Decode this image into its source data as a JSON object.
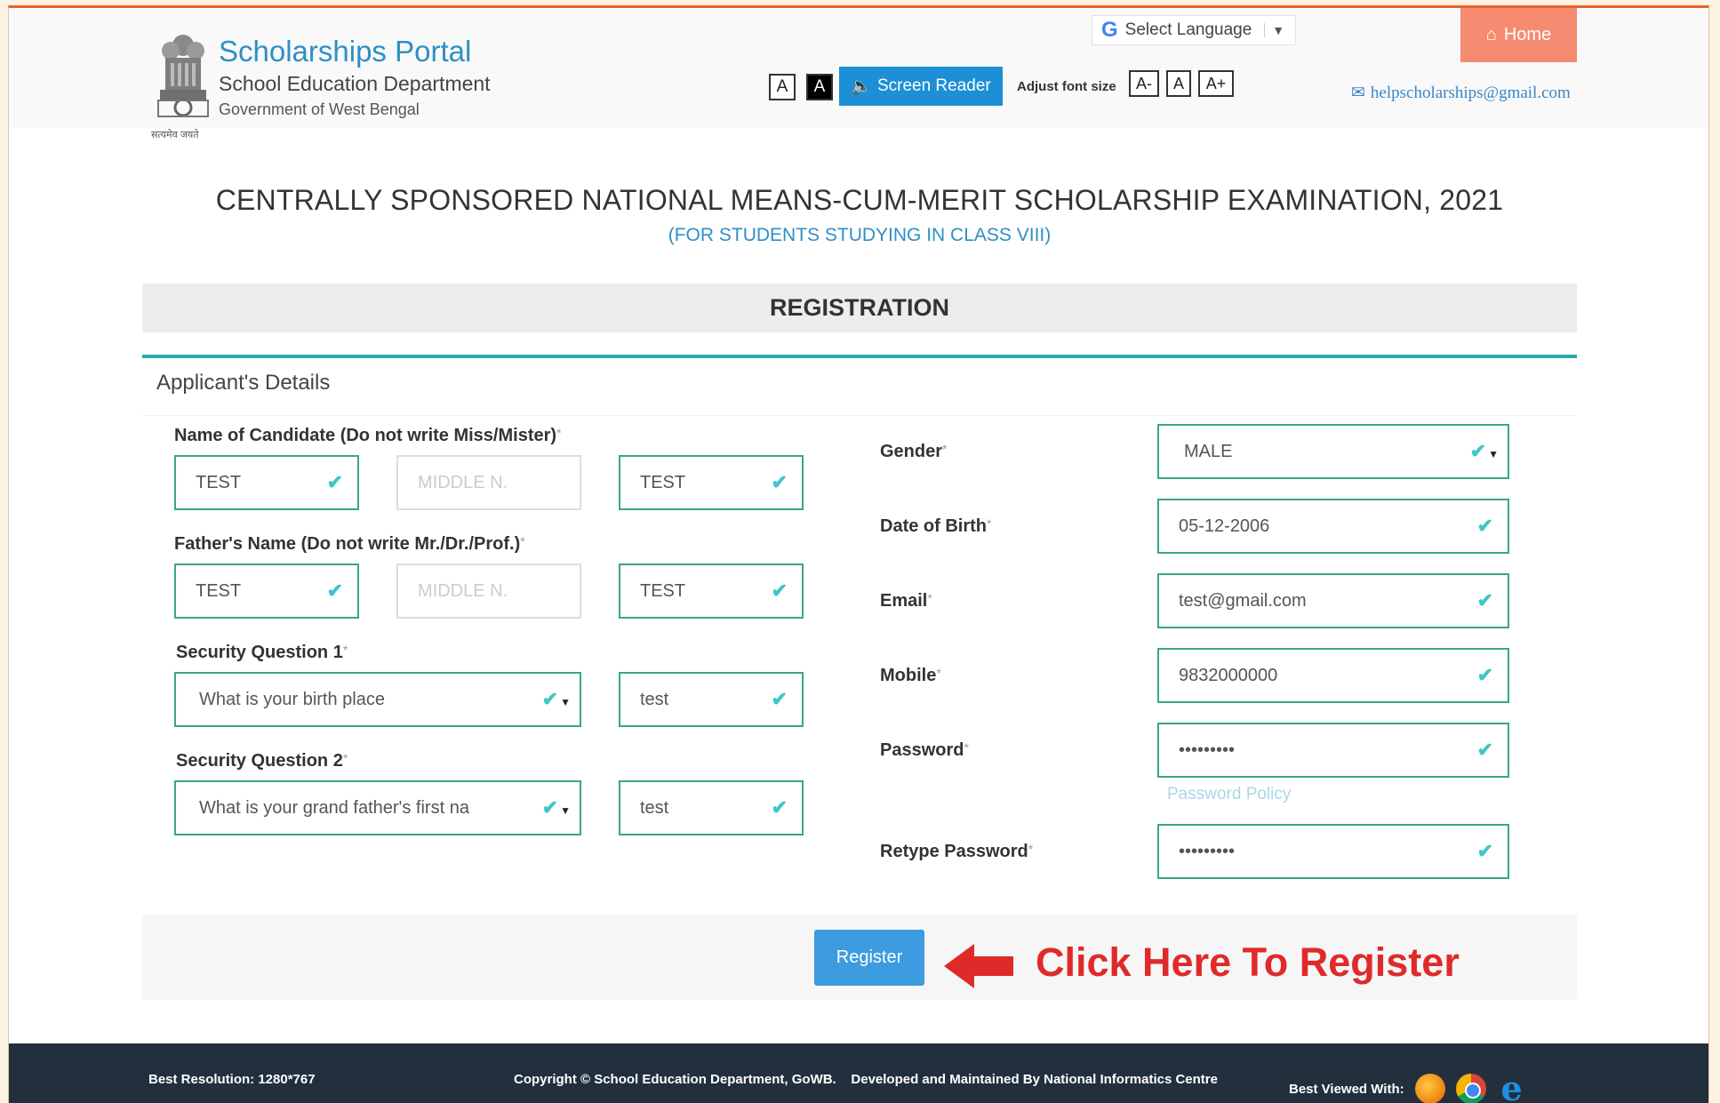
{
  "header": {
    "title": "Scholarships Portal",
    "department": "School Education Department",
    "government": "Government of West Bengal",
    "emblem_caption": "सत्यमेव जयते",
    "language": "Select Language",
    "home": "Home",
    "font_a_light": "A",
    "font_a_dark": "A",
    "screen_reader": "Screen Reader",
    "adjust_font_label": "Adjust font size",
    "font_decrease": "A-",
    "font_normal": "A",
    "font_increase": "A+",
    "email": "helpscholarships@gmail.com"
  },
  "page": {
    "title": "CENTRALLY SPONSORED NATIONAL MEANS-CUM-MERIT SCHOLARSHIP EXAMINATION, 2021",
    "subtitle": "(FOR STUDENTS STUDYING IN CLASS VIII)",
    "section": "REGISTRATION",
    "panel_title": "Applicant's Details"
  },
  "form": {
    "candidate_label": "Name of Candidate (Do not write Miss/Mister)",
    "candidate_first": "TEST",
    "candidate_middle_placeholder": "MIDDLE N.",
    "candidate_last": "TEST",
    "father_label": "Father's Name (Do not write Mr./Dr./Prof.)",
    "father_first": "TEST",
    "father_middle_placeholder": "MIDDLE N.",
    "father_last": "TEST",
    "sq1_label": "Security Question 1",
    "sq1_question": "What is your birth place",
    "sq1_answer": "test",
    "sq2_label": "Security Question 2",
    "sq2_question": "What is your grand father's first na",
    "sq2_answer": "test",
    "gender_label": "Gender",
    "gender_value": "MALE",
    "dob_label": "Date of Birth",
    "dob_value": "05-12-2006",
    "email_label": "Email",
    "email_value": "test@gmail.com",
    "mobile_label": "Mobile",
    "mobile_value": "9832000000",
    "password_label": "Password",
    "password_value": "•••••••••",
    "password_policy": "Password Policy",
    "retype_label": "Retype Password",
    "retype_value": "•••••••••",
    "required_mark": "*"
  },
  "actions": {
    "register": "Register",
    "annotation": "Click Here To Register"
  },
  "footer": {
    "resolution": "Best Resolution: 1280*767",
    "copyright": "Copyright © School Education Department, GoWB.",
    "developed": "Developed and Maintained By National Informatics Centre",
    "best_viewed": "Best Viewed With:"
  },
  "icons": {
    "home": "home-icon",
    "speaker": "speaker-icon",
    "mail": "mail-icon",
    "check": "check-icon",
    "arrow": "left-arrow-icon"
  },
  "colors": {
    "accent": "#2e8fc6",
    "valid_border": "#3aa77f",
    "check": "#3ec6c9",
    "home_button": "#f58b70",
    "annotation": "#e02a2a",
    "footer_bg": "#22303d"
  }
}
